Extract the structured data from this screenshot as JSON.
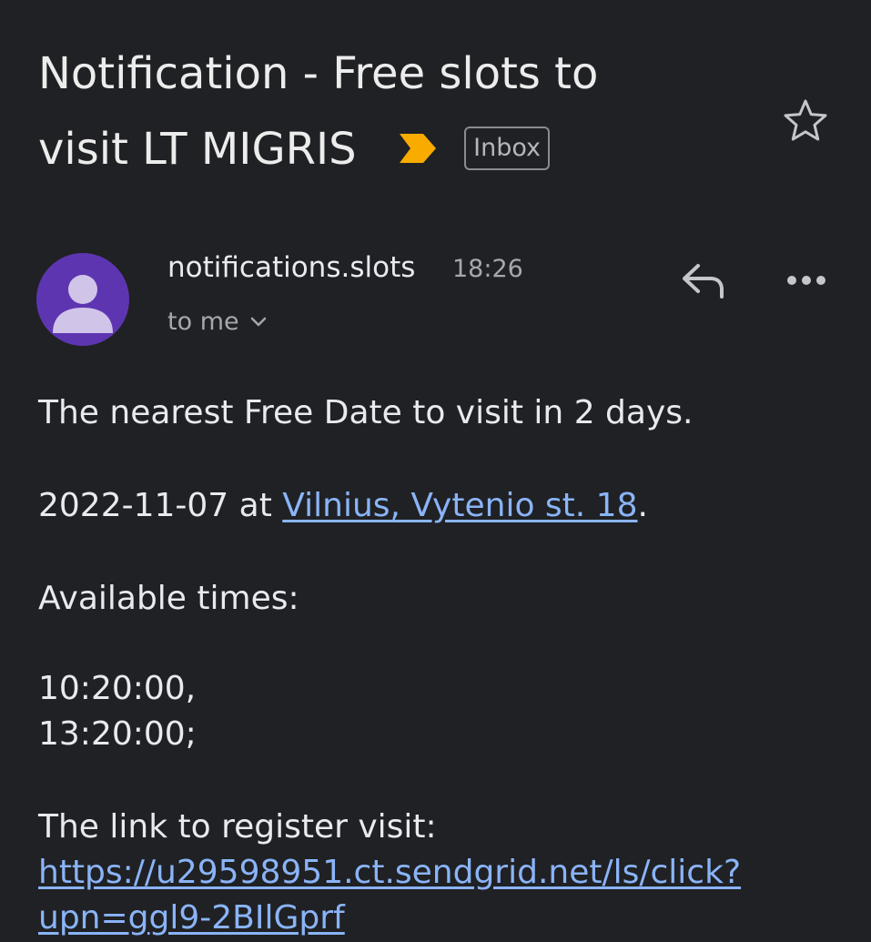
{
  "email": {
    "subject_line1": "Notification - Free slots to",
    "subject_line2": "visit LT MIGRIS",
    "label_badge": "Inbox",
    "sender_name": "notifications.slots",
    "time": "18:26",
    "recipients": "to me"
  },
  "body": {
    "line1": "The nearest Free Date to visit in 2 days.",
    "date": "2022-11-07",
    "at_word": " at ",
    "location_link": "Vilnius, Vytenio st. 18",
    "period": ".",
    "available_label": "Available times:",
    "time1": "10:20:00,",
    "time2": "13:20:00;",
    "register_label": "The link to register visit:",
    "register_link_line1": "https://u29598951.ct.sendgrid.net/ls/click?",
    "register_link_line2": "upn=ggl9-2BIlGprf"
  },
  "icons": {
    "important": "important-marker-icon",
    "star": "star-icon",
    "avatar": "person-icon",
    "recipients_toggle": "chevron-down-icon",
    "reply": "reply-icon",
    "more": "more-horizontal-icon"
  },
  "colors": {
    "background": "#202124",
    "avatar": "#5e35b1",
    "important": "#f9ab00",
    "link": "#8ab4f8"
  }
}
